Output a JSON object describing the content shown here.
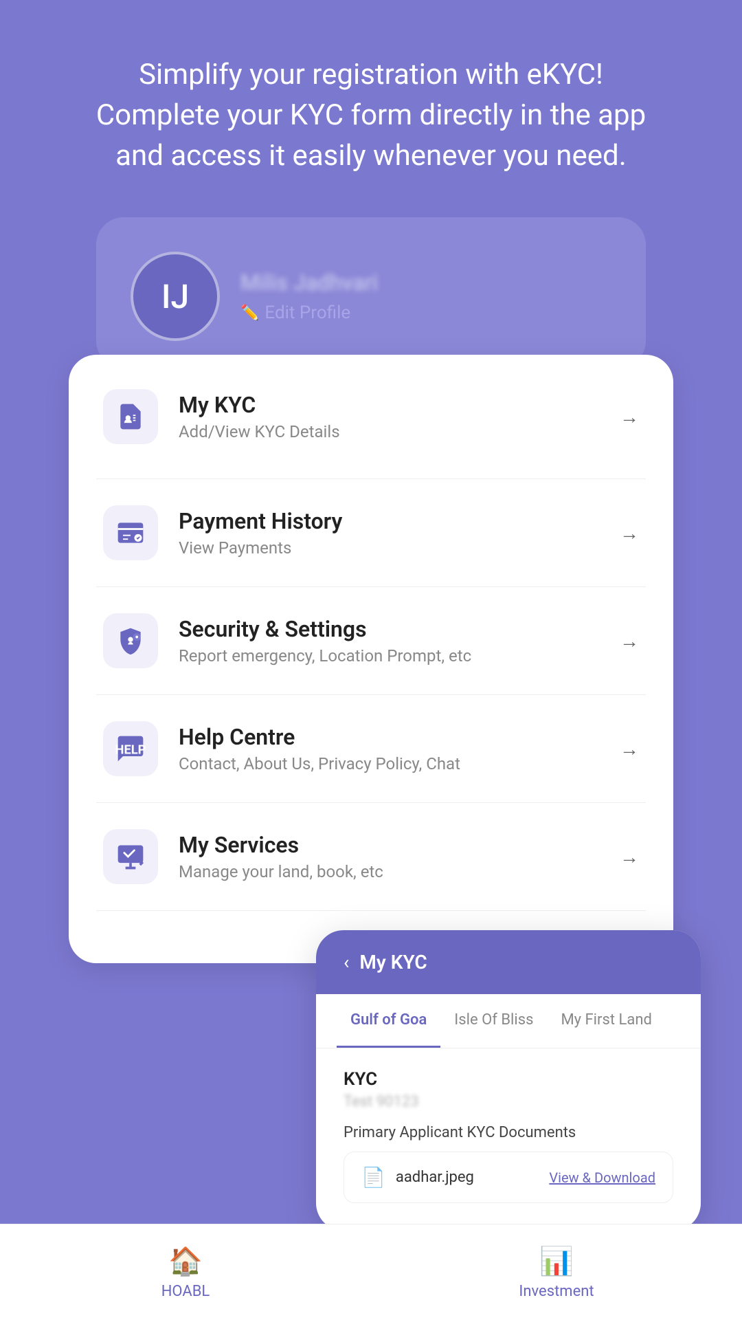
{
  "header": {
    "tagline": "Simplify your registration with eKYC!\nComplete your KYC form directly in the app\nand access it easily whenever you need."
  },
  "profile": {
    "initials": "IJ",
    "name": "Milis Jadhvari",
    "edit_label": "Edit Profile"
  },
  "menu": {
    "items": [
      {
        "id": "kyc",
        "title": "My KYC",
        "subtitle": "Add/View KYC Details"
      },
      {
        "id": "payment",
        "title": "Payment History",
        "subtitle": "View Payments"
      },
      {
        "id": "security",
        "title": "Security & Settings",
        "subtitle": "Report emergency, Location Prompt, etc"
      },
      {
        "id": "help",
        "title": "Help Centre",
        "subtitle": "Contact, About Us, Privacy Policy, Chat"
      },
      {
        "id": "services",
        "title": "My Services",
        "subtitle": "Manage your land, book, etc"
      }
    ]
  },
  "kyc_detail": {
    "back_label": "‹",
    "title": "My KYC",
    "tabs": [
      {
        "label": "Gulf of Goa",
        "active": true
      },
      {
        "label": "Isle Of Bliss",
        "active": false
      },
      {
        "label": "My First Land",
        "active": false
      }
    ],
    "kyc_label": "KYC",
    "kyc_id": "Test 90123",
    "section_title": "Primary Applicant KYC Documents",
    "document": {
      "name": "aadhar.jpeg",
      "link_label": "View & Download"
    }
  },
  "bottom_nav": {
    "items": [
      {
        "label": "HOABL",
        "icon": "🏠"
      },
      {
        "label": "Investment",
        "icon": "📊"
      }
    ]
  }
}
